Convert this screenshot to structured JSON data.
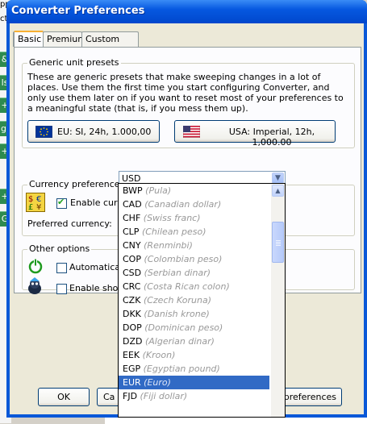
{
  "background_app": {
    "fragment_top": "pp",
    "fragment_2": "ctc",
    "buttons": [
      "&",
      "ls",
      "+",
      "gi",
      "+",
      "+",
      "G"
    ]
  },
  "window": {
    "title": "Converter Preferences"
  },
  "tabs": [
    {
      "label": "Basic",
      "active": true
    },
    {
      "label": "Premium",
      "active": false
    },
    {
      "label": "Custom units",
      "active": false
    }
  ],
  "generic": {
    "legend": "Generic unit presets",
    "description": "These are generic presets that make sweeping changes in a lot of places. Use them the first time you start configuring Converter, and only use them later on if you want to reset most of your preferences to a meaningful state (that is, if you mess them up).",
    "eu_button": "EU: SI, 24h, 1.000,00",
    "usa_button": "USA: Imperial, 12h, 1,000.00"
  },
  "currency": {
    "legend": "Currency preferences",
    "enable_label": "Enable currency conversions",
    "enable_checked": true,
    "preferred_label": "Preferred currency:",
    "selected": "USD"
  },
  "other": {
    "legend": "Other options",
    "auto_label": "Automaticall",
    "shop_label": "Enable shop"
  },
  "currency_list": [
    {
      "code": "BWP",
      "name": "(Pula)"
    },
    {
      "code": "CAD",
      "name": "(Canadian dollar)"
    },
    {
      "code": "CHF",
      "name": "(Swiss franc)"
    },
    {
      "code": "CLP",
      "name": "(Chilean peso)"
    },
    {
      "code": "CNY",
      "name": "(Renminbi)"
    },
    {
      "code": "COP",
      "name": "(Colombian peso)"
    },
    {
      "code": "CSD",
      "name": "(Serbian dinar)"
    },
    {
      "code": "CRC",
      "name": "(Costa Rican colon)"
    },
    {
      "code": "CZK",
      "name": "(Czech Koruna)"
    },
    {
      "code": "DKK",
      "name": "(Danish krone)"
    },
    {
      "code": "DOP",
      "name": "(Dominican peso)"
    },
    {
      "code": "DZD",
      "name": "(Algerian dinar)"
    },
    {
      "code": "EEK",
      "name": "(Kroon)"
    },
    {
      "code": "EGP",
      "name": "(Egyptian pound)"
    },
    {
      "code": "EUR",
      "name": "(Euro)",
      "selected": true
    },
    {
      "code": "FJD",
      "name": "(Fiji dollar)"
    }
  ],
  "footer": {
    "ok": "OK",
    "cancel": "Ca",
    "prefs": "preferences"
  },
  "colors": {
    "title_bar": "#0658e0",
    "selection": "#316ac5",
    "dialog_bg": "#ece9d8"
  }
}
